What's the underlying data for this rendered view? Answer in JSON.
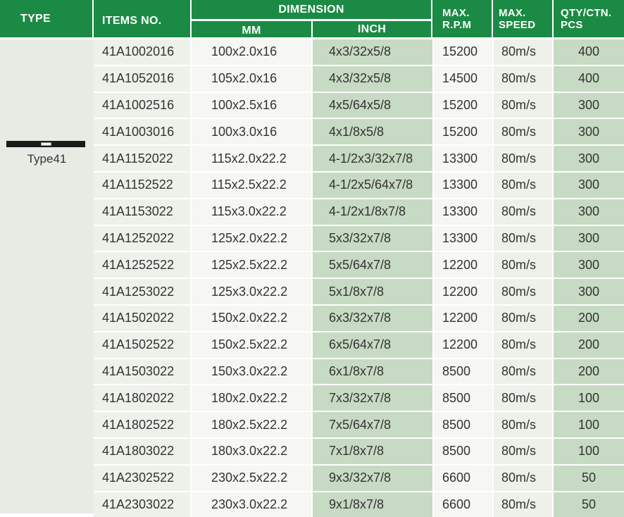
{
  "header": {
    "type": "TYPE",
    "items_no": "ITEMS NO.",
    "dimension": "DIMENSION",
    "mm": "MM",
    "inch": "INCH",
    "max_rpm_line1": "MAX.",
    "max_rpm_line2": "R.P.M",
    "max_speed_line1": "MAX.",
    "max_speed_line2": "SPEED",
    "qty_line1": "QTY/CTN.",
    "qty_line2": "PCS"
  },
  "type_label": "Type41",
  "colors": {
    "header_green": "#1b8a44",
    "inch_column": "#c7dac3",
    "qty_column": "#c7dac3",
    "type_column": "#e6ece3"
  },
  "rows": [
    {
      "item": "41A1002016",
      "mm": "100x2.0x16",
      "inch": "4x3/32x5/8",
      "rpm": "15200",
      "speed": "80m/s",
      "qty": "400"
    },
    {
      "item": "41A1052016",
      "mm": "105x2.0x16",
      "inch": "4x3/32x5/8",
      "rpm": "14500",
      "speed": "80m/s",
      "qty": "400"
    },
    {
      "item": "41A1002516",
      "mm": "100x2.5x16",
      "inch": "4x5/64x5/8",
      "rpm": "15200",
      "speed": "80m/s",
      "qty": "300"
    },
    {
      "item": "41A1003016",
      "mm": "100x3.0x16",
      "inch": "4x1/8x5/8",
      "rpm": "15200",
      "speed": "80m/s",
      "qty": "300"
    },
    {
      "item": "41A1152022",
      "mm": "115x2.0x22.2",
      "inch": "4-1/2x3/32x7/8",
      "rpm": "13300",
      "speed": "80m/s",
      "qty": "300"
    },
    {
      "item": "41A1152522",
      "mm": "115x2.5x22.2",
      "inch": "4-1/2x5/64x7/8",
      "rpm": "13300",
      "speed": "80m/s",
      "qty": "300"
    },
    {
      "item": "41A1153022",
      "mm": "115x3.0x22.2",
      "inch": "4-1/2x1/8x7/8",
      "rpm": "13300",
      "speed": "80m/s",
      "qty": "300"
    },
    {
      "item": "41A1252022",
      "mm": "125x2.0x22.2",
      "inch": "5x3/32x7/8",
      "rpm": "13300",
      "speed": "80m/s",
      "qty": "300"
    },
    {
      "item": "41A1252522",
      "mm": "125x2.5x22.2",
      "inch": "5x5/64x7/8",
      "rpm": "12200",
      "speed": "80m/s",
      "qty": "300"
    },
    {
      "item": "41A1253022",
      "mm": "125x3.0x22.2",
      "inch": "5x1/8x7/8",
      "rpm": "12200",
      "speed": "80m/s",
      "qty": "300"
    },
    {
      "item": "41A1502022",
      "mm": "150x2.0x22.2",
      "inch": "6x3/32x7/8",
      "rpm": "12200",
      "speed": "80m/s",
      "qty": "200"
    },
    {
      "item": "41A1502522",
      "mm": "150x2.5x22.2",
      "inch": "6x5/64x7/8",
      "rpm": "12200",
      "speed": "80m/s",
      "qty": "200"
    },
    {
      "item": "41A1503022",
      "mm": "150x3.0x22.2",
      "inch": "6x1/8x7/8",
      "rpm": "8500",
      "speed": "80m/s",
      "qty": "200"
    },
    {
      "item": "41A1802022",
      "mm": "180x2.0x22.2",
      "inch": "7x3/32x7/8",
      "rpm": "8500",
      "speed": "80m/s",
      "qty": "100"
    },
    {
      "item": "41A1802522",
      "mm": "180x2.5x22.2",
      "inch": "7x5/64x7/8",
      "rpm": "8500",
      "speed": "80m/s",
      "qty": "100"
    },
    {
      "item": "41A1803022",
      "mm": "180x3.0x22.2",
      "inch": "7x1/8x7/8",
      "rpm": "8500",
      "speed": "80m/s",
      "qty": "100"
    },
    {
      "item": "41A2302522",
      "mm": "230x2.5x22.2",
      "inch": "9x3/32x7/8",
      "rpm": "6600",
      "speed": "80m/s",
      "qty": "50"
    },
    {
      "item": "41A2303022",
      "mm": "230x3.0x22.2",
      "inch": "9x1/8x7/8",
      "rpm": "6600",
      "speed": "80m/s",
      "qty": "50"
    }
  ]
}
